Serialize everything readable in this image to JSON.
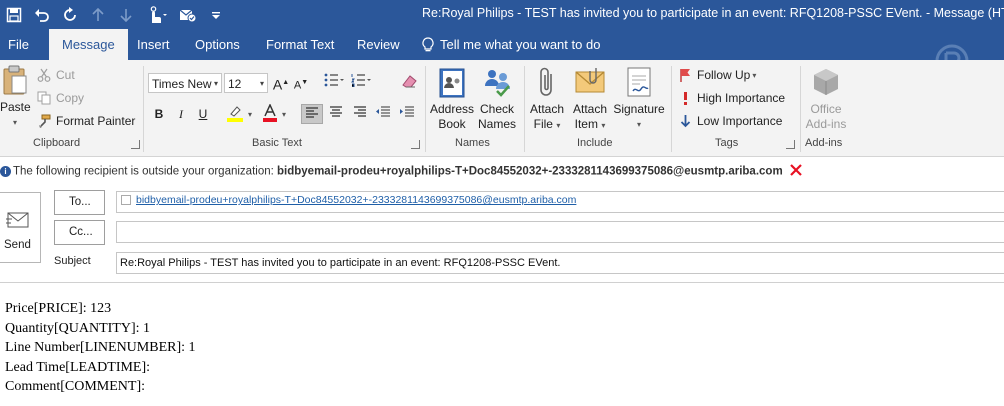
{
  "window": {
    "title": "Re:Royal Philips - TEST has invited you to participate in an event: RFQ1208-PSSC EVent.  -  Message (HTML)"
  },
  "qat": {
    "icons": [
      "save-icon",
      "undo-icon",
      "redo-icon",
      "up-arrow-icon",
      "down-arrow-icon",
      "touch-mode-icon",
      "email-check-icon",
      "customize-icon"
    ]
  },
  "tabs": {
    "file": "File",
    "message": "Message",
    "insert": "Insert",
    "options": "Options",
    "format_text": "Format Text",
    "review": "Review",
    "tell_me": "Tell me what you want to do"
  },
  "ribbon": {
    "clipboard": {
      "label": "Clipboard",
      "paste": "Paste",
      "cut": "Cut",
      "copy": "Copy",
      "format_painter": "Format Painter"
    },
    "basic_text": {
      "label": "Basic Text",
      "font_name": "Times New",
      "font_size": "12",
      "bold": "B",
      "italic": "I",
      "underline": "U"
    },
    "names": {
      "label": "Names",
      "address_book_1": "Address",
      "address_book_2": "Book",
      "check_names_1": "Check",
      "check_names_2": "Names"
    },
    "include": {
      "label": "Include",
      "attach_file_1": "Attach",
      "attach_file_2": "File",
      "attach_item_1": "Attach",
      "attach_item_2": "Item",
      "signature": "Signature"
    },
    "tags": {
      "label": "Tags",
      "follow_up": "Follow Up",
      "high_importance": "High Importance",
      "low_importance": "Low Importance"
    },
    "addins": {
      "label": "Add-ins",
      "office_addins_1": "Office",
      "office_addins_2": "Add-ins"
    }
  },
  "infobar": {
    "prefix": "The following recipient is outside your organization: ",
    "address": "bidbyemail-prodeu+royalphilips-T+Doc84552032+-2333281143699375086@eusmtp.ariba.com"
  },
  "compose": {
    "send": "Send",
    "to_button": "To...",
    "cc_button": "Cc...",
    "subject_label": "Subject",
    "to_value": "bidbyemail-prodeu+royalphilips-T+Doc84552032+-2333281143699375086@eusmtp.ariba.com",
    "cc_value": "",
    "subject_value": "Re:Royal Philips - TEST has invited you to participate in an event: RFQ1208-PSSC EVent."
  },
  "body": {
    "lines": [
      "Price[PRICE]: 123",
      "Quantity[QUANTITY]: 1",
      "Line Number[LINENUMBER]: 1",
      "Lead Time[LEADTIME]:",
      "Comment[COMMENT]:"
    ]
  },
  "colors": {
    "brand": "#2b579a",
    "ribbon_bg": "#f3f3f3",
    "link": "#1f5fa8",
    "error_x": "#e81123"
  }
}
